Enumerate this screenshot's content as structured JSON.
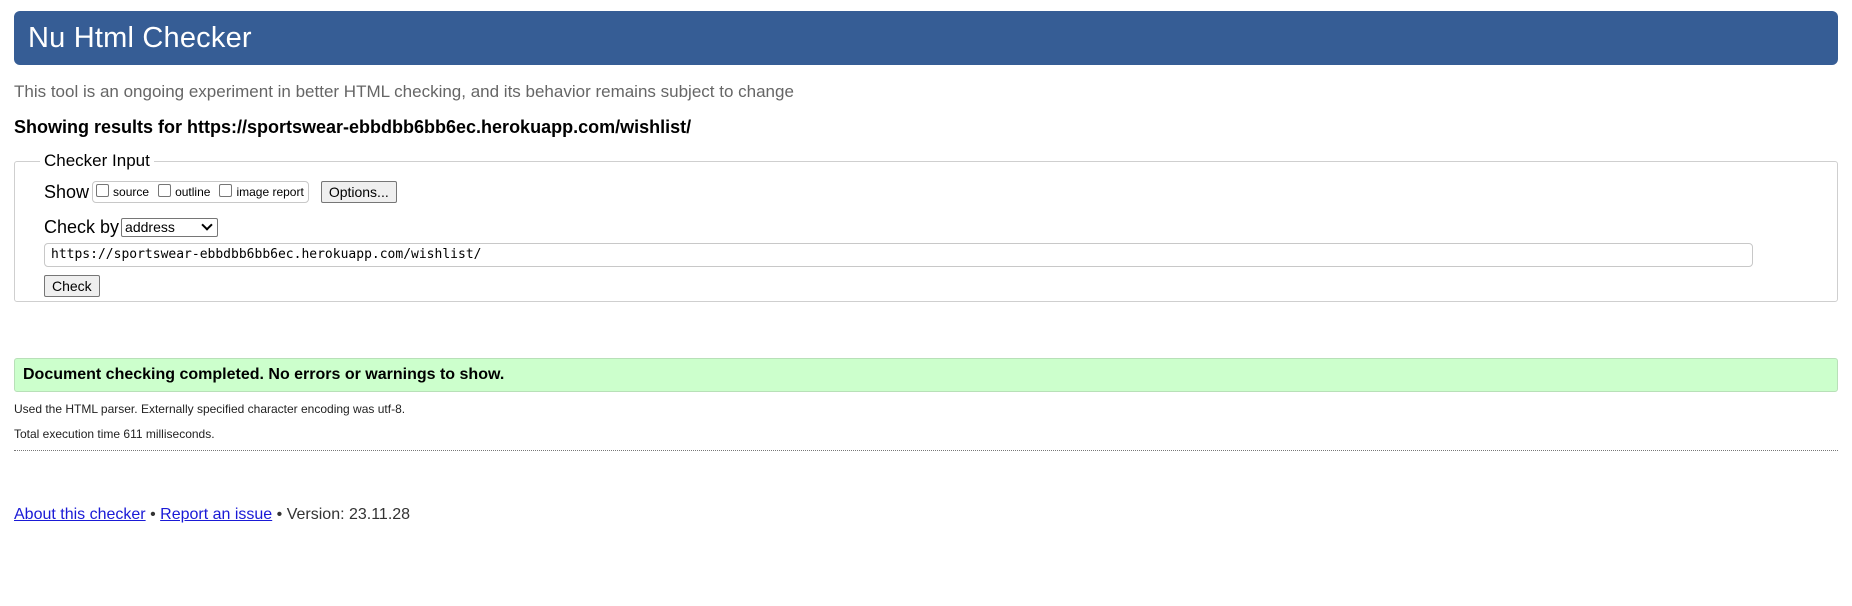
{
  "header": {
    "title": "Nu Html Checker"
  },
  "tagline": "This tool is an ongoing experiment in better HTML checking, and its behavior remains subject to change",
  "results": {
    "prefix": "Showing results for ",
    "url": "https://sportswear-ebbdbb6bb6ec.herokuapp.com/wishlist/"
  },
  "checker_input": {
    "legend": "Checker Input",
    "show_label": "Show",
    "checkboxes": [
      {
        "label": "source",
        "checked": false
      },
      {
        "label": "outline",
        "checked": false
      },
      {
        "label": "image report",
        "checked": false
      }
    ],
    "options_button": "Options...",
    "check_by_label": "Check by",
    "check_by_value": "address",
    "url_value": "https://sportswear-ebbdbb6bb6ec.herokuapp.com/wishlist/",
    "check_button": "Check"
  },
  "status": {
    "message": "Document checking completed. No errors or warnings to show.",
    "parser_note": "Used the HTML parser. Externally specified character encoding was utf-8.",
    "time_note": "Total execution time 611 milliseconds."
  },
  "footer": {
    "about_link": "About this checker",
    "separator": "•",
    "report_link": "Report an issue",
    "version_text": "Version: 23.11.28"
  },
  "colors": {
    "header_bg": "#365d95",
    "success_bg": "#ccffcc",
    "link": "#1a1ad6"
  }
}
